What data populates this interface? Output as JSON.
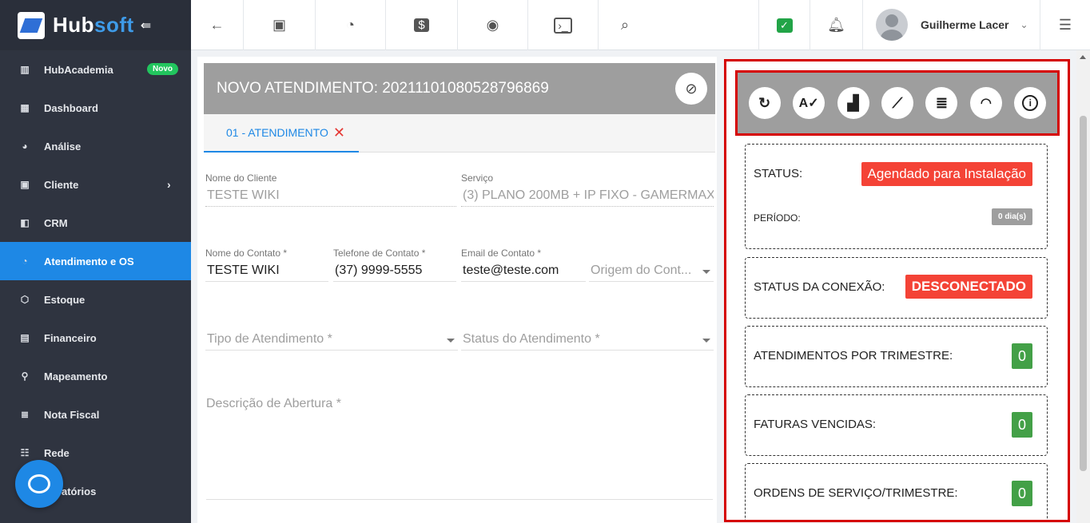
{
  "brand": {
    "name_main": "Hub",
    "name_accent": "soft"
  },
  "sidebar": {
    "items": [
      {
        "label": "HubAcademia",
        "icon": "book-icon",
        "badge": "Novo"
      },
      {
        "label": "Dashboard",
        "icon": "dashboard-icon"
      },
      {
        "label": "Análise",
        "icon": "pie-chart-icon"
      },
      {
        "label": "Cliente",
        "icon": "contact-card-icon",
        "has_submenu": true
      },
      {
        "label": "CRM",
        "icon": "kanban-icon"
      },
      {
        "label": "Atendimento e OS",
        "icon": "calendar-clock-icon",
        "active": true
      },
      {
        "label": "Estoque",
        "icon": "box-icon"
      },
      {
        "label": "Financeiro",
        "icon": "money-icon"
      },
      {
        "label": "Mapeamento",
        "icon": "map-pin-icon"
      },
      {
        "label": "Nota Fiscal",
        "icon": "document-icon"
      },
      {
        "label": "Rede",
        "icon": "network-icon"
      },
      {
        "label": "Relatórios",
        "visible_text": "atórios",
        "icon": "report-icon"
      }
    ]
  },
  "topbar": {
    "buttons": [
      "back-arrow-icon",
      "contact-card-icon",
      "calendar-clock-icon",
      "dollar-icon",
      "eye-icon",
      "terminal-icon",
      "search-icon"
    ],
    "user_name": "Guilherme Lacer"
  },
  "form": {
    "title": "NOVO ATENDIMENTO: 20211101080528796869",
    "tab_label": "01 - ATENDIMENTO",
    "fields": {
      "cliente": {
        "label": "Nome do Cliente",
        "value": "TESTE WIKI"
      },
      "servico": {
        "label": "Serviço",
        "value": "(3) PLANO 200MB + IP FIXO - GAMERMAX"
      },
      "contato": {
        "label": "Nome do Contato *",
        "value": "TESTE WIKI"
      },
      "telefone": {
        "label": "Telefone de Contato *",
        "value": "(37) 9999-5555"
      },
      "email": {
        "label": "Email de Contato *",
        "value": "teste@teste.com"
      },
      "origem": {
        "placeholder": "Origem do Cont..."
      },
      "tipo": {
        "placeholder": "Tipo de Atendimento *"
      },
      "status": {
        "placeholder": "Status do Atendimento *"
      },
      "descricao": {
        "placeholder": "Descrição de Abertura *"
      }
    }
  },
  "panel": {
    "status_label": "STATUS:",
    "status_value": "Agendado para Instalação",
    "periodo_label": "PERÍODO:",
    "periodo_value": "0 dia(s)",
    "conexao_label": "STATUS DA CONEXÃO:",
    "conexao_value": "DESCONECTADO",
    "atendimentos_label": "ATENDIMENTOS POR TRIMESTRE:",
    "atendimentos_value": "0",
    "faturas_label": "FATURAS VENCIDAS:",
    "faturas_value": "0",
    "ordens_label": "ORDENS DE SERVIÇO/TRIMESTRE:",
    "ordens_value": "0"
  },
  "colors": {
    "sidebar_bg": "#2f3440",
    "active_blue": "#1e88e5",
    "alert_red": "#f44336",
    "panel_border_red": "#d50000",
    "ok_green": "#43a047"
  }
}
